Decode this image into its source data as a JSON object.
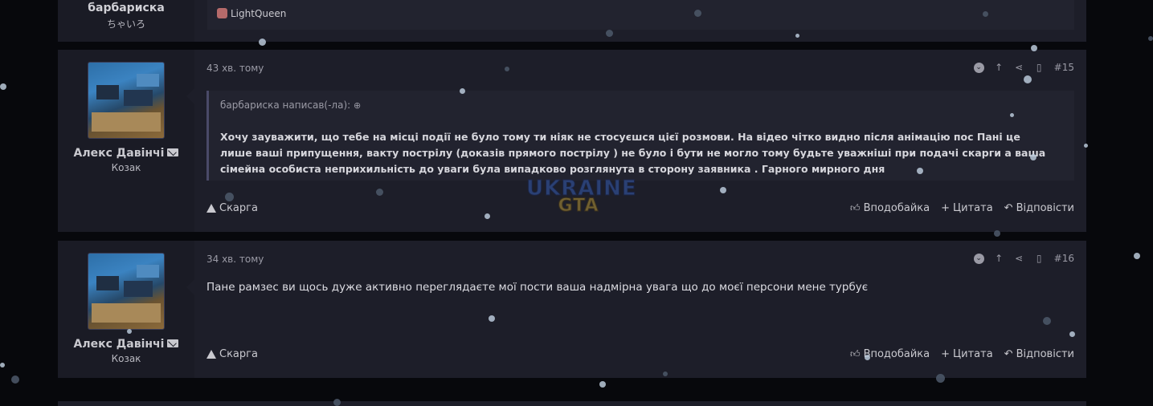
{
  "prev_post": {
    "username": "барбариска",
    "usertitle": "ちゃいろ",
    "reaction_user": "LightQueen"
  },
  "posts": [
    {
      "username": "Алекс Давінчі",
      "usertitle": "Козак",
      "time": "43 хв. тому",
      "number": "#15",
      "quote_author": "барбариска написав(-ла):",
      "quote_text": "Хочу зауважити, що тебе на місці події не було тому ти ніяк не стосуєшся цієї розмови. На відео чітко видно після анімацію пос Пані це лише ваші припущення, вакту пострілу (доказів прямого пострілу ) не було і бути не могло тому будьте уважніші при подачі скарги а ваша сімейна особиста неприхильність до уваги була випадково розглянута в сторону заявника . Гарного мирного дня",
      "report": "Скарга",
      "like": "Вподобайка",
      "quote": "Цитата",
      "reply": "Відповісти"
    },
    {
      "username": "Алекс Давінчі",
      "usertitle": "Козак",
      "time": "34 хв. тому",
      "number": "#16",
      "text": "Пане рамзес ви щось дуже активно переглядаєте мої пости ваша надмірна увага що до моєї персони мене турбує",
      "report": "Скарга",
      "like": "Вподобайка",
      "quote": "Цитата",
      "reply": "Відповісти"
    }
  ],
  "watermark": {
    "line1": "UKRAINE",
    "line2": "GTA"
  }
}
